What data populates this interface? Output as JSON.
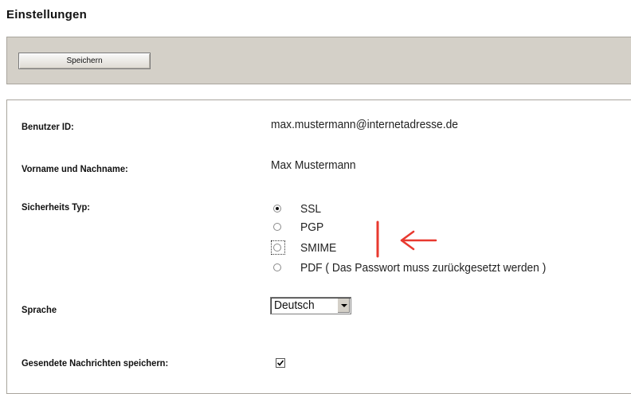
{
  "page": {
    "title": "Einstellungen"
  },
  "toolbar": {
    "save_label": "Speichern"
  },
  "form": {
    "user_id": {
      "label": "Benutzer ID:",
      "value": "max.mustermann@internetadresse.de"
    },
    "name": {
      "label": "Vorname und Nachname:",
      "value": "Max Mustermann"
    },
    "security": {
      "label": "Sicherheits Typ:",
      "options": [
        {
          "label": "SSL",
          "selected": true
        },
        {
          "label": "PGP",
          "selected": false
        },
        {
          "label": "SMIME",
          "selected": false,
          "focused": true
        },
        {
          "label": "PDF ( Das Passwort muss zurückgesetzt werden )",
          "selected": false
        }
      ]
    },
    "language": {
      "label": "Sprache",
      "value": "Deutsch"
    },
    "save_sent": {
      "label": "Gesendete Nachrichten speichern:",
      "checked": true
    }
  },
  "annotation": {
    "color": "#e8392f",
    "icon": "red-arrow-left-icon"
  }
}
